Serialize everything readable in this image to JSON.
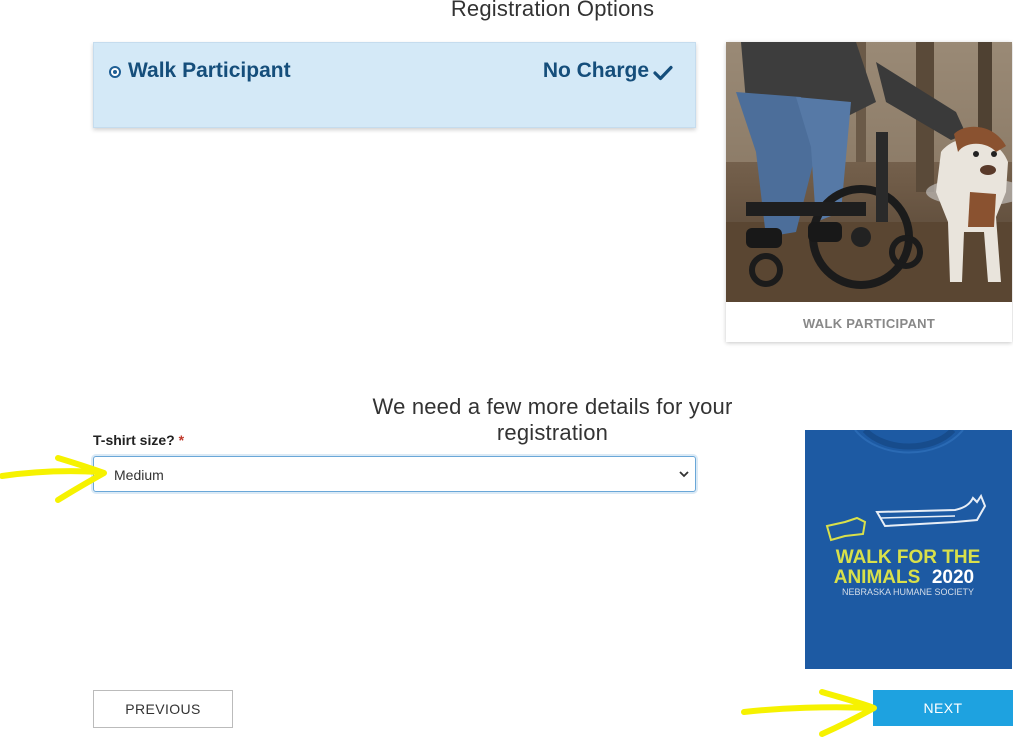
{
  "header": {
    "registration_title": "Registration Options"
  },
  "option": {
    "name": "Walk Participant",
    "price": "No Charge",
    "selected": true
  },
  "participant_card": {
    "caption": "WALK PARTICIPANT"
  },
  "details": {
    "title": "We need a few more details for your registration"
  },
  "form": {
    "tshirt_label": "T-shirt size?",
    "required_mark": "*",
    "tshirt_value": "Medium"
  },
  "shirt_image": {
    "line1": "WALK FOR THE",
    "line2a": "ANIMALS",
    "line2b": "2020",
    "line3": "NEBRASKA HUMANE SOCIETY"
  },
  "buttons": {
    "previous": "PREVIOUS",
    "next": "NEXT"
  },
  "colors": {
    "option_bg": "#d4e9f7",
    "option_text": "#154e7b",
    "next_button": "#1ea2e0",
    "shirt": "#1d5aa3",
    "shirt_text": "#d9e04a",
    "annotation": "#f6f200"
  },
  "icons": {
    "check": "checkmark-icon",
    "radio": "radio-selected-icon",
    "select": "chevron-down-icon"
  }
}
